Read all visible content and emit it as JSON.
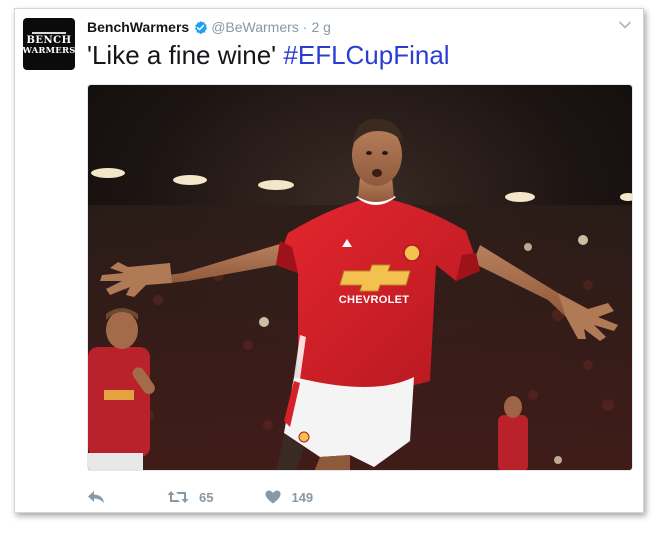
{
  "tweet": {
    "avatar": {
      "line1": "BENCH",
      "line2": "WARMERS"
    },
    "display_name": "BenchWarmers",
    "verified": true,
    "handle": "@BeWarmers",
    "separator": "·",
    "time": "2 g",
    "text": "'Like a fine wine'",
    "hashtag": "#EFLCupFinal",
    "media": {
      "jersey_sponsor": "CHEVROLET"
    },
    "actions": {
      "reply_icon": "reply-icon",
      "retweet_icon": "retweet-icon",
      "retweet_count": "65",
      "like_icon": "heart-icon",
      "like_count": "149"
    },
    "colors": {
      "hashtag": "#2b3ed4",
      "verified": "#1da1f2",
      "muted": "#8899a6",
      "jersey_red": "#d6202a"
    }
  }
}
